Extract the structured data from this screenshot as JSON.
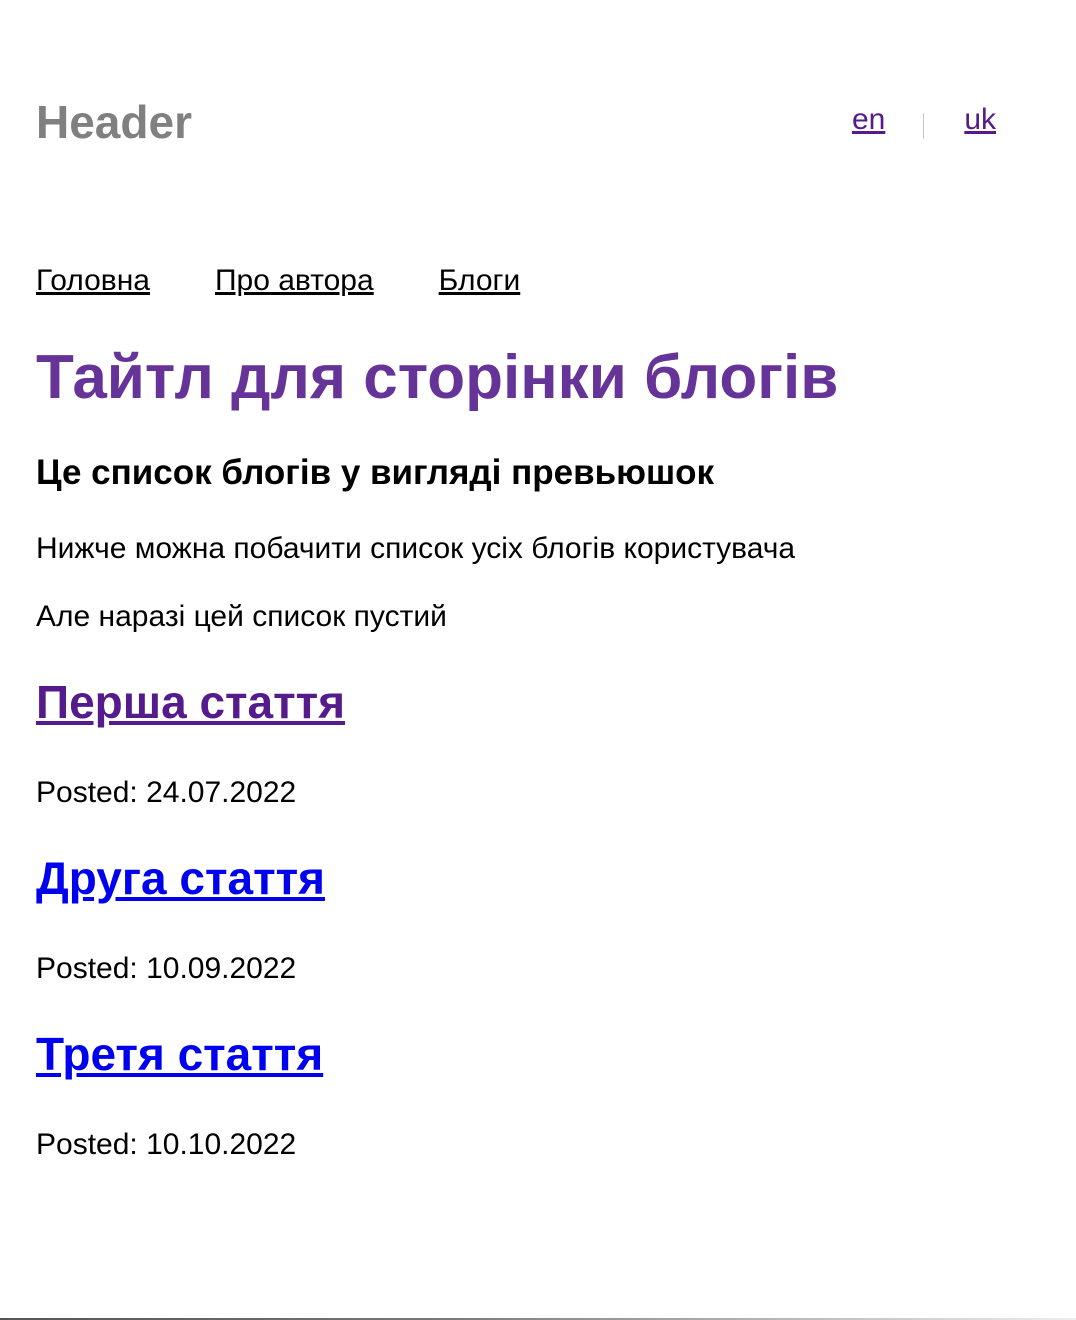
{
  "header": {
    "brand": "Header",
    "languages": [
      {
        "label": "en"
      },
      {
        "label": "uk"
      }
    ]
  },
  "nav": {
    "items": [
      {
        "label": "Головна"
      },
      {
        "label": "Про автора"
      },
      {
        "label": "Блоги"
      }
    ]
  },
  "main": {
    "title": "Тайтл для сторінки блогів",
    "subtitle": "Це список блогів у вигляді превьюшок",
    "paragraphs": [
      "Нижче можна побачити список усіх блогів користувача",
      "Але наразі цей список пустий"
    ],
    "posts": [
      {
        "title": "Перша стаття",
        "date": "Posted: 24.07.2022"
      },
      {
        "title": "Друга стаття",
        "date": "Posted: 10.09.2022"
      },
      {
        "title": "Третя стаття",
        "date": "Posted: 10.10.2022"
      }
    ]
  },
  "colors": {
    "brand_gray": "#808080",
    "title_purple": "#663399",
    "visited_link": "#551a8b",
    "unvisited_link": "#0000ee"
  }
}
